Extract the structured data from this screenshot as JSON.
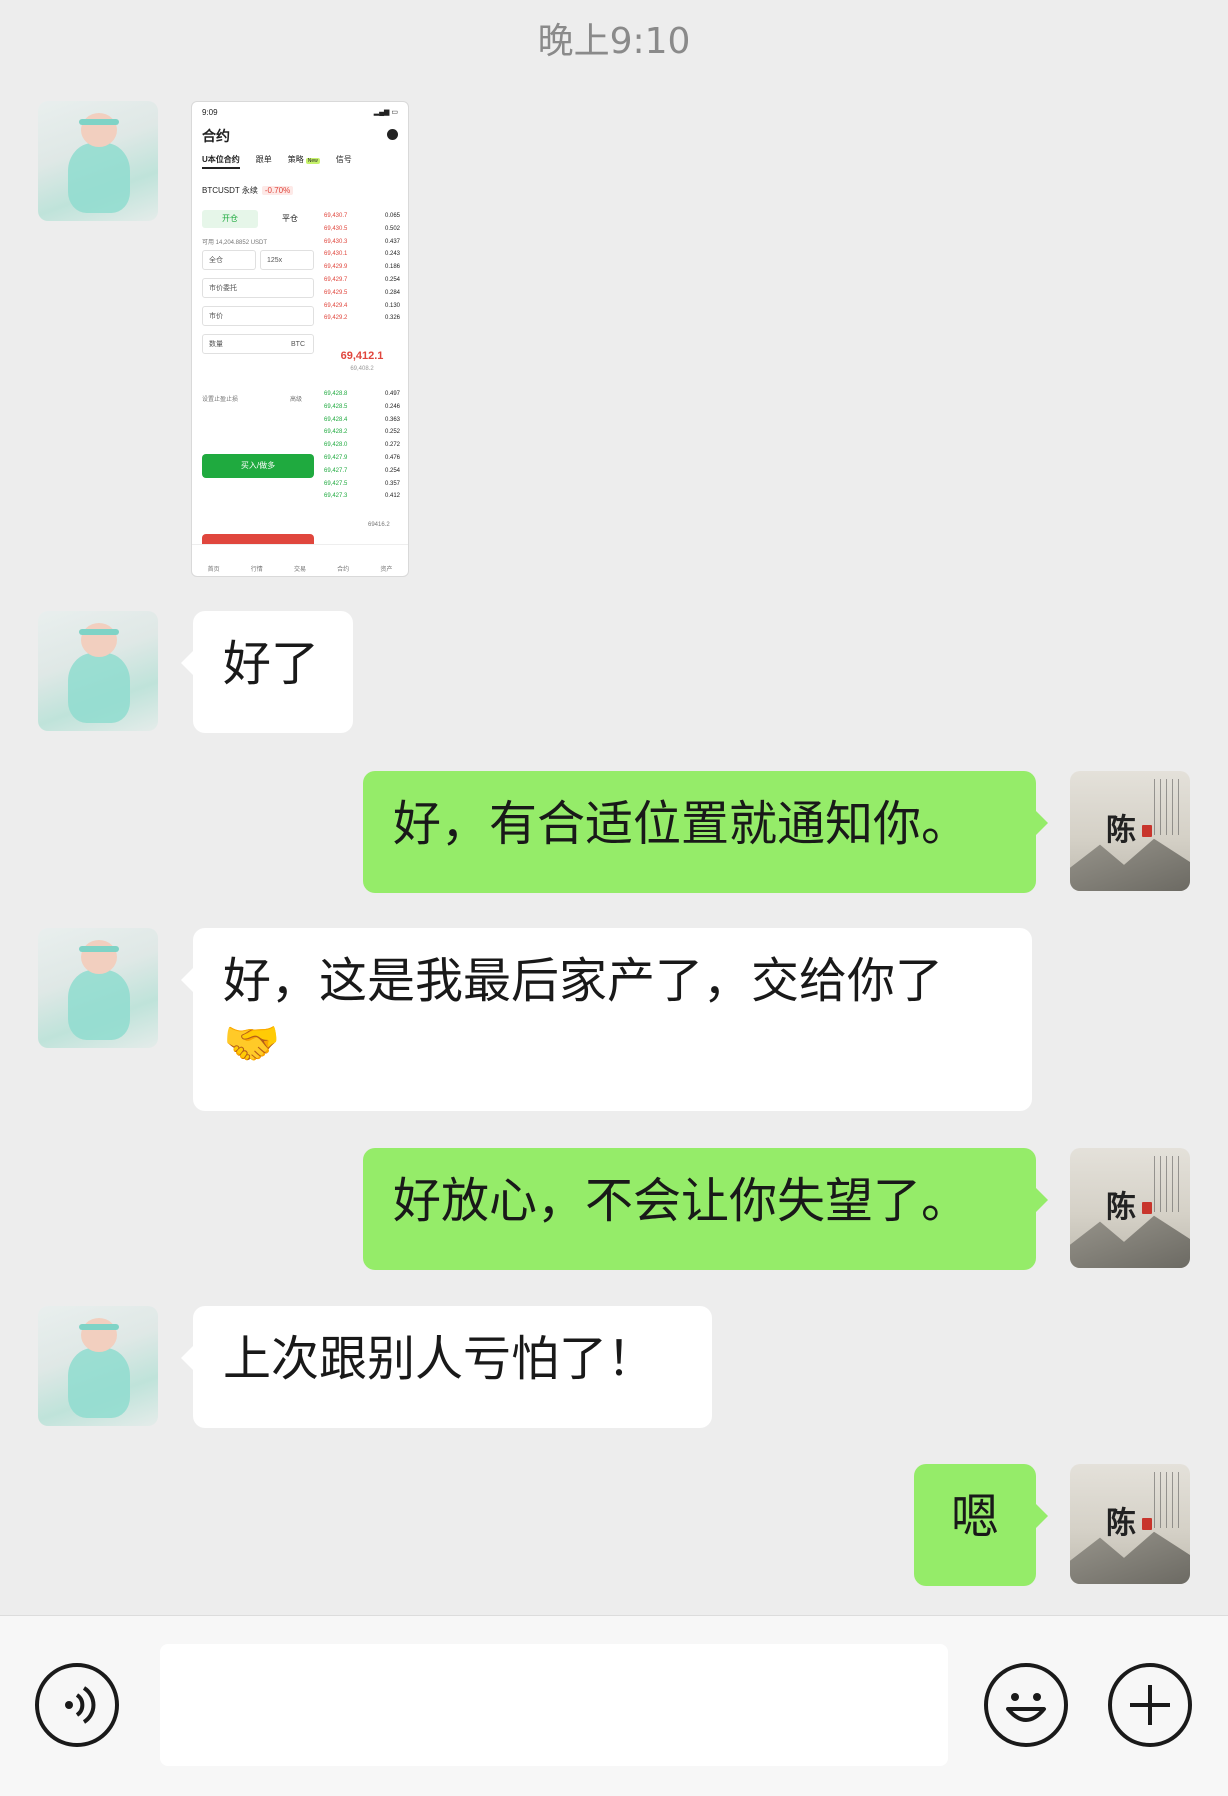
{
  "header": {
    "time": "晚上9:10"
  },
  "messages": [
    {
      "side": "in",
      "type": "image"
    },
    {
      "side": "in",
      "type": "text",
      "text": "好了"
    },
    {
      "side": "out",
      "type": "text",
      "text": "好，有合适位置就通知你。"
    },
    {
      "side": "in",
      "type": "text",
      "text": "好，这是我最后家产了，交给你了",
      "emoji": "🤝"
    },
    {
      "side": "out",
      "type": "text",
      "text": "好放心，不会让你失望了。"
    },
    {
      "side": "in",
      "type": "text",
      "text": "上次跟别人亏怕了！"
    },
    {
      "side": "out",
      "type": "text",
      "text": "嗯"
    }
  ],
  "avatar_text": {
    "seal_char": "陈"
  },
  "thumbnail": {
    "status_time": "9:09",
    "title": "合约",
    "tabs": [
      "U本位合约",
      "跟单",
      "策略",
      "信号"
    ],
    "new_badge": "New",
    "pair": "BTCUSDT 永续",
    "change": "-0.70%",
    "open_label": "开仓",
    "close_label": "平仓",
    "available": "可用  14,204.8852 USDT",
    "margin_mode": "全仓",
    "leverage": "125x",
    "order_type": "市价委托",
    "price_placeholder": "市价",
    "qty_placeholder": "数量",
    "qty_unit": "BTC",
    "tpsl": "设置止盈止损",
    "advanced": "高级",
    "buy_label": "买入/做多",
    "asks": [
      [
        "69,430.7",
        "0.065"
      ],
      [
        "69,430.5",
        "0.502"
      ],
      [
        "69,430.3",
        "0.437"
      ],
      [
        "69,430.1",
        "0.243"
      ],
      [
        "69,429.9",
        "0.186"
      ],
      [
        "69,429.7",
        "0.254"
      ],
      [
        "69,429.5",
        "0.284"
      ],
      [
        "69,429.4",
        "0.130"
      ],
      [
        "69,429.2",
        "0.326"
      ]
    ],
    "mid_price": "69,412.1",
    "mark_price": "69,408.2",
    "bids": [
      [
        "69,428.8",
        "0.497"
      ],
      [
        "69,428.5",
        "0.246"
      ],
      [
        "69,428.4",
        "0.363"
      ],
      [
        "69,428.2",
        "0.252"
      ],
      [
        "69,428.0",
        "0.272"
      ],
      [
        "69,427.9",
        "0.476"
      ],
      [
        "69,427.7",
        "0.254"
      ],
      [
        "69,427.5",
        "0.357"
      ],
      [
        "69,427.3",
        "0.412"
      ]
    ],
    "funding_price": "69416.2",
    "nav": [
      "首页",
      "行情",
      "交易",
      "合约",
      "资产"
    ]
  }
}
